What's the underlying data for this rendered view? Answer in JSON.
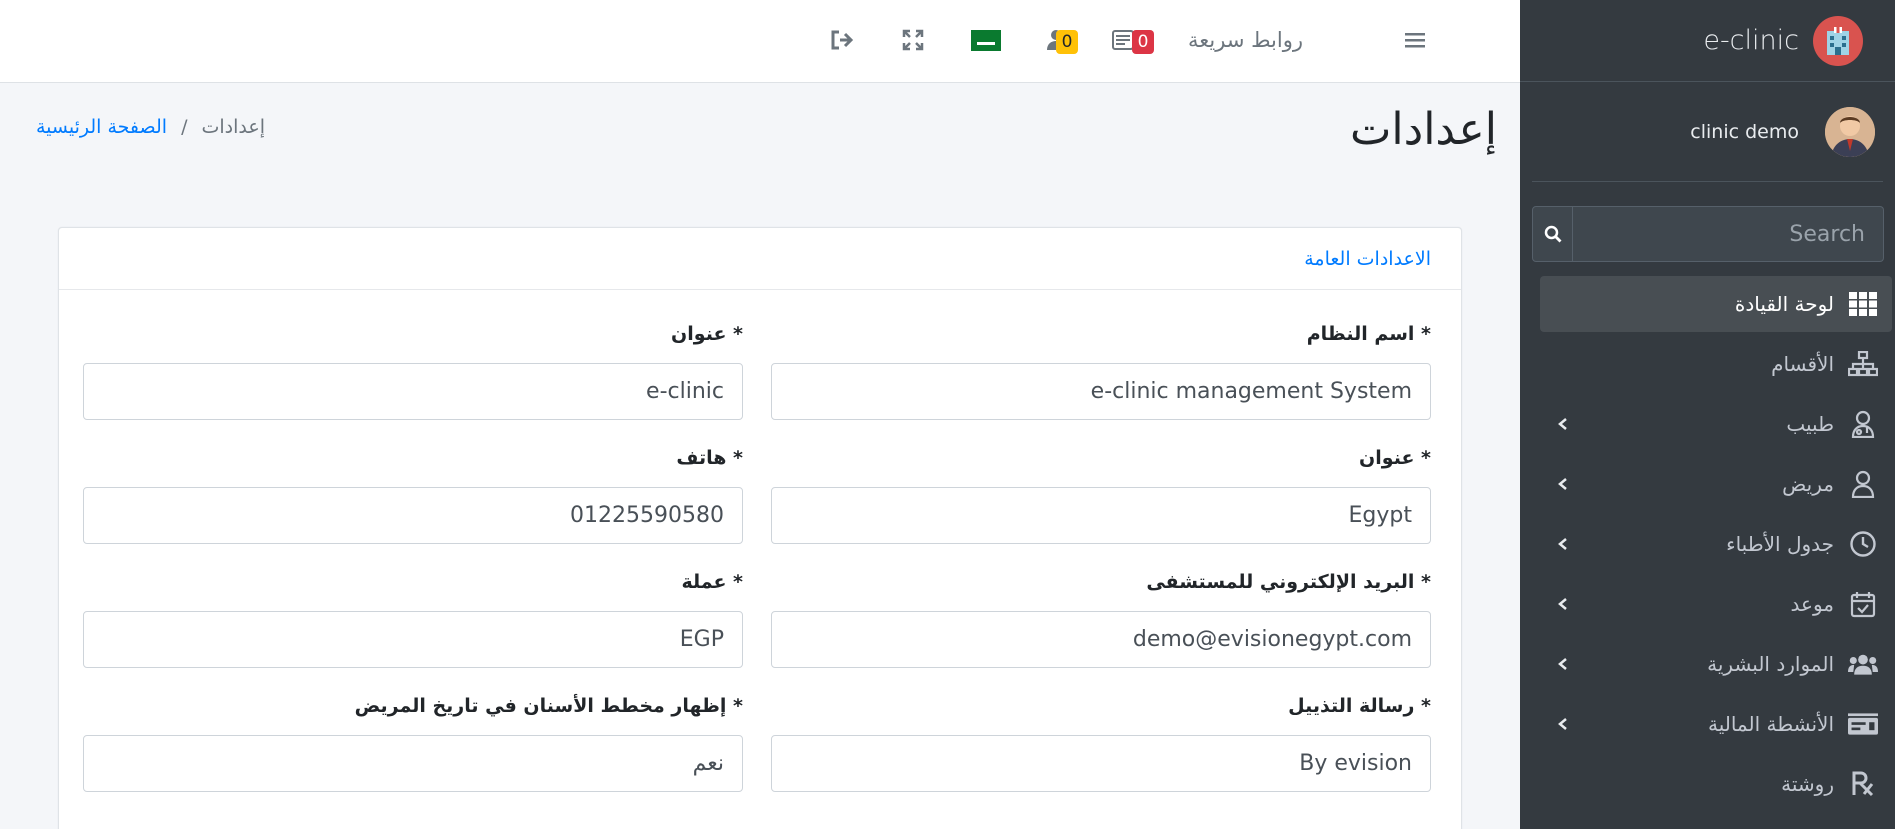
{
  "brand": {
    "name": "e-clinic"
  },
  "user": {
    "name": "clinic demo"
  },
  "search": {
    "placeholder": "Search"
  },
  "nav": [
    {
      "label": "لوحة القيادة",
      "icon": "grid-icon",
      "active": true,
      "chevron": false
    },
    {
      "label": "الأقسام",
      "icon": "sitemap-icon",
      "active": false,
      "chevron": false
    },
    {
      "label": "طبيب",
      "icon": "doctor-icon",
      "active": false,
      "chevron": true
    },
    {
      "label": "مريض",
      "icon": "user-icon",
      "active": false,
      "chevron": true
    },
    {
      "label": "جدول الأطباء",
      "icon": "clock-icon",
      "active": false,
      "chevron": true
    },
    {
      "label": "موعد",
      "icon": "calendar-check-icon",
      "active": false,
      "chevron": true
    },
    {
      "label": "الموارد البشرية",
      "icon": "users-icon",
      "active": false,
      "chevron": true
    },
    {
      "label": "الأنشطة المالية",
      "icon": "money-check-icon",
      "active": false,
      "chevron": true
    },
    {
      "label": "روشتة",
      "icon": "prescription-icon",
      "active": false,
      "chevron": false
    }
  ],
  "topbar": {
    "quick_links": "روابط سريعة",
    "messages_count": "0",
    "users_count": "0"
  },
  "page": {
    "title": "إعدادات",
    "breadcrumb_home": "الصفحة الرئيسية",
    "breadcrumb_sep": "/",
    "breadcrumb_current": "إعدادات"
  },
  "card": {
    "title": "الاعدادات العامة",
    "fields": {
      "system_name": {
        "label": "اسم النظام *",
        "value": "e-clinic management System"
      },
      "title": {
        "label": "عنوان *",
        "value": "e-clinic"
      },
      "address": {
        "label": "عنوان *",
        "value": "Egypt"
      },
      "phone": {
        "label": "هاتف *",
        "value": "01225590580"
      },
      "email": {
        "label": "البريد الإلكتروني للمستشفى *",
        "value": "demo@evisionegypt.com"
      },
      "currency": {
        "label": "عملة *",
        "value": "EGP"
      },
      "footer": {
        "label": "رسالة التذييل *",
        "value": "By evision"
      },
      "dental_chart": {
        "label": "إظهار مخطط الأسنان في تاريخ المريض *",
        "value": "نعم"
      }
    }
  },
  "colors": {
    "sidebar": "#343a40",
    "accent": "#007bff",
    "badge_red": "#dc3545",
    "badge_yellow": "#ffc107"
  }
}
